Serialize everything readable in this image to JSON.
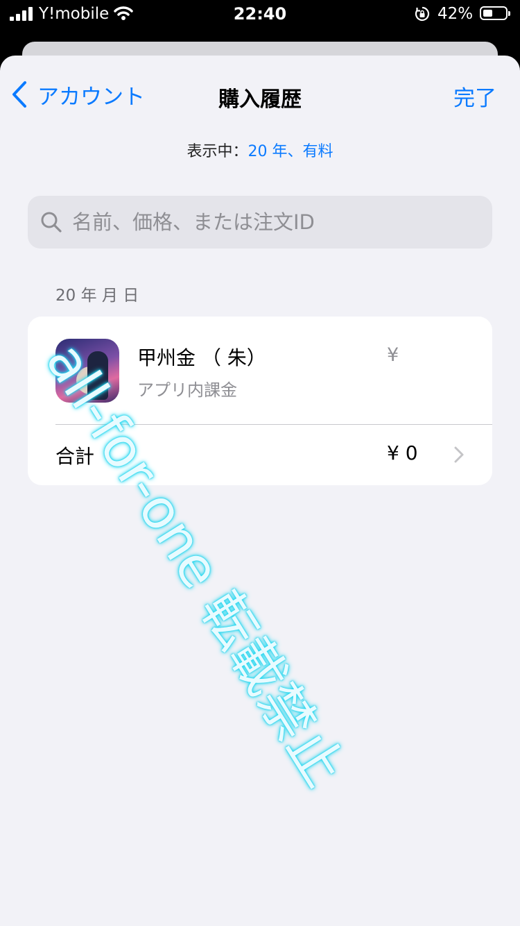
{
  "status_bar": {
    "carrier": "Y!mobile",
    "time": "22:40",
    "battery_percent": "42%",
    "battery_level": 0.42
  },
  "nav": {
    "back_label": "アカウント",
    "title": "購入履歴",
    "done_label": "完了"
  },
  "filter": {
    "prefix": "表示中：",
    "value": "20 年、有料"
  },
  "search": {
    "placeholder": "名前、価格、または注文ID",
    "value": ""
  },
  "purchase_group": {
    "date": "20 年 月 日",
    "item": {
      "name": "甲州金 （ 朱）",
      "type": "アプリ内課金",
      "price": "¥"
    },
    "total_label": "合計",
    "total_value": "¥  0"
  },
  "watermark": "all-for-one 転載禁止",
  "colors": {
    "accent": "#0a7aff",
    "background": "#f2f2f7",
    "card": "#ffffff",
    "secondary_text": "#8e8e93",
    "watermark_glow": "#20d8f0"
  }
}
